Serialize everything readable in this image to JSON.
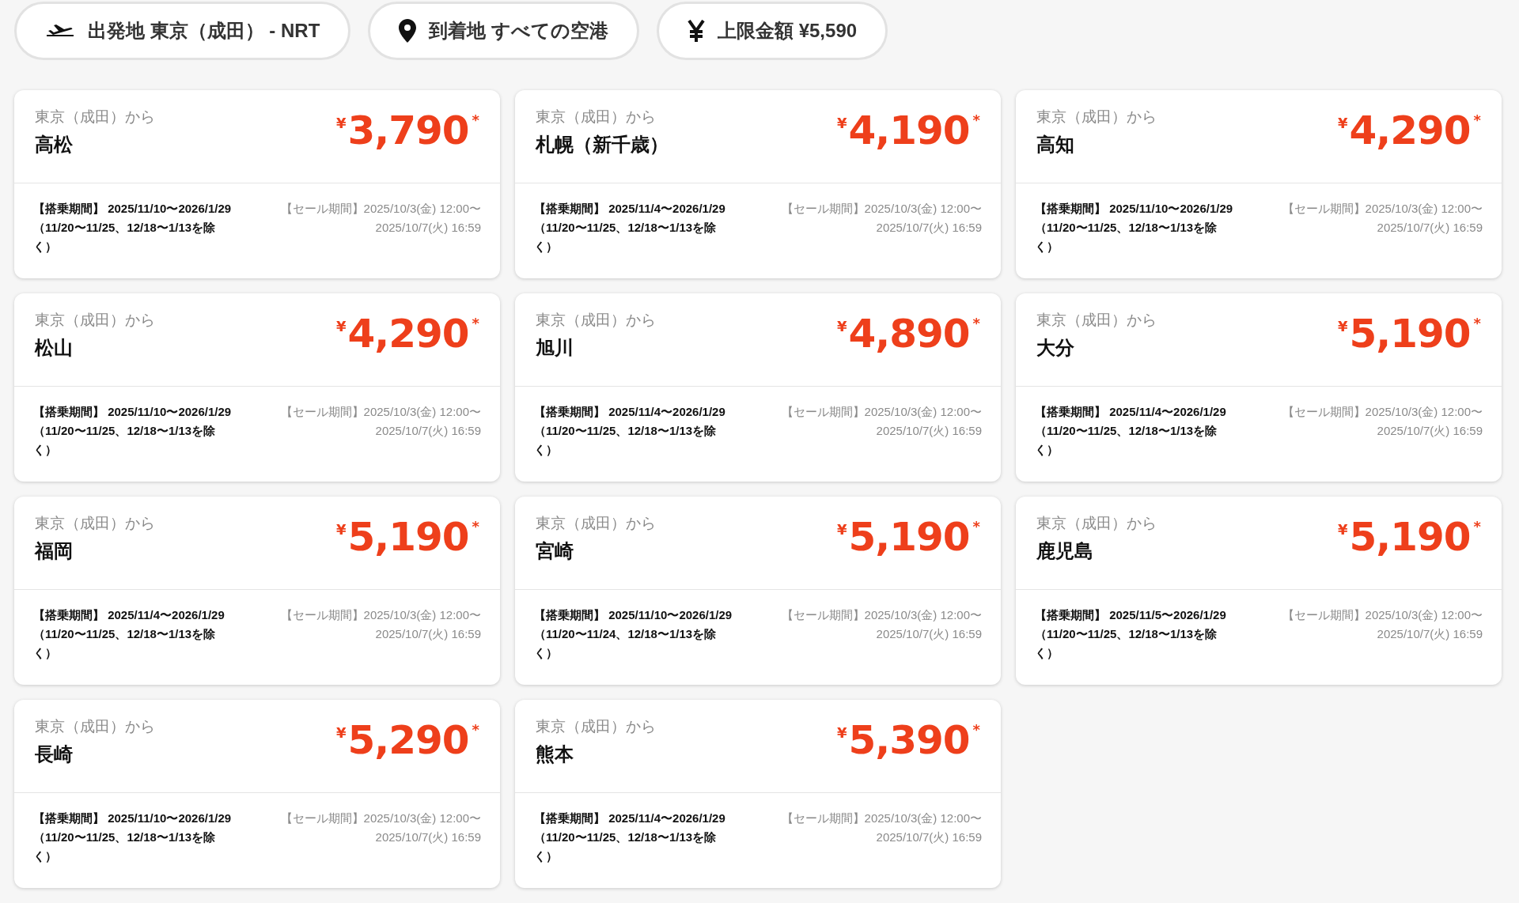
{
  "filters": [
    {
      "kind": "plane",
      "label": "出発地 東京（成田） - NRT"
    },
    {
      "kind": "pin",
      "label": "到着地 すべての空港"
    },
    {
      "kind": "yen",
      "label": "上限金額 ¥5,590"
    }
  ],
  "fares": [
    {
      "origin": "東京（成田）から",
      "destination": "高松",
      "currency": "¥",
      "amount": "3,790",
      "note_mark": "*",
      "boarding_period": "【搭乗期間】 2025/11/10〜2026/1/29 （11/20〜11/25、12/18〜1/13を除く）",
      "sale_period": "【セール期間】2025/10/3(金) 12:00〜2025/10/7(火) 16:59"
    },
    {
      "origin": "東京（成田）から",
      "destination": "札幌（新千歳）",
      "currency": "¥",
      "amount": "4,190",
      "note_mark": "*",
      "boarding_period": "【搭乗期間】 2025/11/4〜2026/1/29 （11/20〜11/25、12/18〜1/13を除く）",
      "sale_period": "【セール期間】2025/10/3(金) 12:00〜2025/10/7(火) 16:59"
    },
    {
      "origin": "東京（成田）から",
      "destination": "高知",
      "currency": "¥",
      "amount": "4,290",
      "note_mark": "*",
      "boarding_period": "【搭乗期間】 2025/11/10〜2026/1/29 （11/20〜11/25、12/18〜1/13を除く）",
      "sale_period": "【セール期間】2025/10/3(金) 12:00〜2025/10/7(火) 16:59"
    },
    {
      "origin": "東京（成田）から",
      "destination": "松山",
      "currency": "¥",
      "amount": "4,290",
      "note_mark": "*",
      "boarding_period": "【搭乗期間】 2025/11/10〜2026/1/29 （11/20〜11/25、12/18〜1/13を除く）",
      "sale_period": "【セール期間】2025/10/3(金) 12:00〜2025/10/7(火) 16:59"
    },
    {
      "origin": "東京（成田）から",
      "destination": "旭川",
      "currency": "¥",
      "amount": "4,890",
      "note_mark": "*",
      "boarding_period": "【搭乗期間】 2025/11/4〜2026/1/29 （11/20〜11/25、12/18〜1/13を除く）",
      "sale_period": "【セール期間】2025/10/3(金) 12:00〜2025/10/7(火) 16:59"
    },
    {
      "origin": "東京（成田）から",
      "destination": "大分",
      "currency": "¥",
      "amount": "5,190",
      "note_mark": "*",
      "boarding_period": "【搭乗期間】 2025/11/4〜2026/1/29 （11/20〜11/25、12/18〜1/13を除く）",
      "sale_period": "【セール期間】2025/10/3(金) 12:00〜2025/10/7(火) 16:59"
    },
    {
      "origin": "東京（成田）から",
      "destination": "福岡",
      "currency": "¥",
      "amount": "5,190",
      "note_mark": "*",
      "boarding_period": "【搭乗期間】 2025/11/4〜2026/1/29 （11/20〜11/25、12/18〜1/13を除く）",
      "sale_period": "【セール期間】2025/10/3(金) 12:00〜2025/10/7(火) 16:59"
    },
    {
      "origin": "東京（成田）から",
      "destination": "宮崎",
      "currency": "¥",
      "amount": "5,190",
      "note_mark": "*",
      "boarding_period": "【搭乗期間】 2025/11/10〜2026/1/29 （11/20〜11/24、12/18〜1/13を除く）",
      "sale_period": "【セール期間】2025/10/3(金) 12:00〜2025/10/7(火) 16:59"
    },
    {
      "origin": "東京（成田）から",
      "destination": "鹿児島",
      "currency": "¥",
      "amount": "5,190",
      "note_mark": "*",
      "boarding_period": "【搭乗期間】 2025/11/5〜2026/1/29 （11/20〜11/25、12/18〜1/13を除く）",
      "sale_period": "【セール期間】2025/10/3(金) 12:00〜2025/10/7(火) 16:59"
    },
    {
      "origin": "東京（成田）から",
      "destination": "長崎",
      "currency": "¥",
      "amount": "5,290",
      "note_mark": "*",
      "boarding_period": "【搭乗期間】 2025/11/10〜2026/1/29 （11/20〜11/25、12/18〜1/13を除く）",
      "sale_period": "【セール期間】2025/10/3(金) 12:00〜2025/10/7(火) 16:59"
    },
    {
      "origin": "東京（成田）から",
      "destination": "熊本",
      "currency": "¥",
      "amount": "5,390",
      "note_mark": "*",
      "boarding_period": "【搭乗期間】 2025/11/4〜2026/1/29 （11/20〜11/25、12/18〜1/13を除く）",
      "sale_period": "【セール期間】2025/10/3(金) 12:00〜2025/10/7(火) 16:59"
    }
  ]
}
